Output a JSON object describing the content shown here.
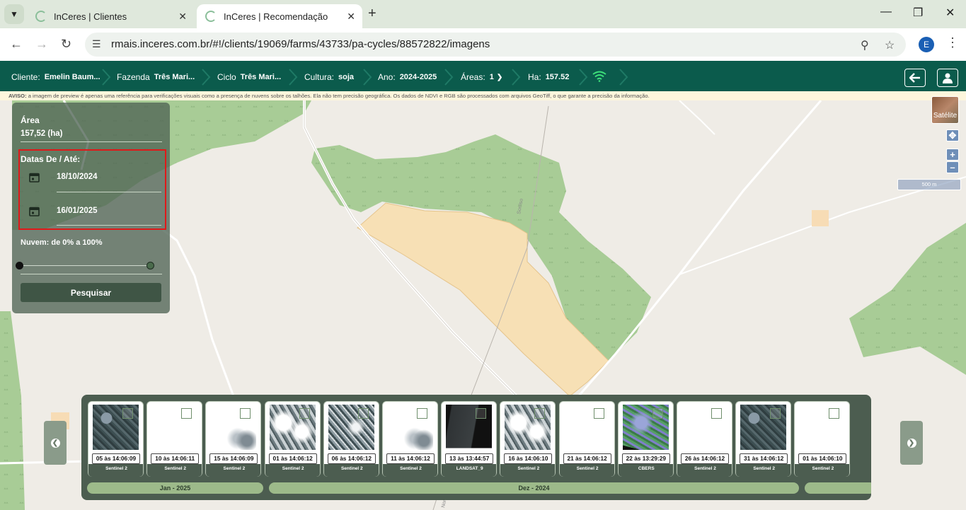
{
  "browser": {
    "tabs": [
      {
        "title": "InCeres | Clientes"
      },
      {
        "title": "InCeres | Recomendação"
      }
    ],
    "url": "rmais.inceres.com.br/#!/clients/19069/farms/43733/pa-cycles/88572822/imagens",
    "profile_initial": "E"
  },
  "header": {
    "cliente_label": "Cliente:",
    "cliente_value": "Emelin Baum...",
    "fazenda_label": "Fazenda",
    "fazenda_value": "Três Mari...",
    "ciclo_label": "Ciclo",
    "ciclo_value": "Três Mari...",
    "cultura_label": "Cultura:",
    "cultura_value": "soja",
    "ano_label": "Ano:",
    "ano_value": "2024-2025",
    "areas_label": "Áreas:",
    "areas_value": "1",
    "ha_label": "Ha:",
    "ha_value": "157.52"
  },
  "warning": {
    "prefix": "AVISO:",
    "text": " a imagem de preview é apenas uma referência para verificações visuais como a presença de nuvens sobre os talhões. Ela não tem precisão geográfica. Os dados de NDVI e RGB são processados com arquivos GeoTiff, o que garante a precisão da informação."
  },
  "panel": {
    "area_label": "Área",
    "area_value": "157,52 (ha)",
    "dates_label": "Datas De / Até:",
    "date_from": "18/10/2024",
    "date_to": "16/01/2025",
    "cloud_label": "Nuvem: de 0% a 100%",
    "cloud_min_pct": 0,
    "cloud_max_pct": 100,
    "search_label": "Pesquisar"
  },
  "map": {
    "satellite_label": "Satélite",
    "scale_label": "500 m",
    "road_labels": [
      "Sorriso",
      "Norte"
    ]
  },
  "images": [
    {
      "date": "05 às 14:06:09",
      "source": "Sentinel 2",
      "style": "forest"
    },
    {
      "date": "10 às 14:06:11",
      "source": "Sentinel 2",
      "style": "white"
    },
    {
      "date": "15 às 14:06:09",
      "source": "Sentinel 2",
      "style": "cloud-light"
    },
    {
      "date": "01 às 14:06:12",
      "source": "Sentinel 2",
      "style": "cloud-mixed"
    },
    {
      "date": "06 às 14:06:12",
      "source": "Sentinel 2",
      "style": "forest-cloud"
    },
    {
      "date": "11 às 14:06:12",
      "source": "Sentinel 2",
      "style": "cloud-light"
    },
    {
      "date": "13 às 13:44:57",
      "source": "LANDSAT_9",
      "style": "dark"
    },
    {
      "date": "16 às 14:06:10",
      "source": "Sentinel 2",
      "style": "cloud-mixed"
    },
    {
      "date": "21 às 14:06:12",
      "source": "Sentinel 2",
      "style": "white"
    },
    {
      "date": "22 às 13:29:29",
      "source": "CBERS",
      "style": "cbers"
    },
    {
      "date": "26 às 14:06:12",
      "source": "Sentinel 2",
      "style": "white"
    },
    {
      "date": "31 às 14:06:12",
      "source": "Sentinel 2",
      "style": "forest"
    },
    {
      "date": "01 às 14:06:10",
      "source": "Sentinel 2",
      "style": "white"
    }
  ],
  "months": [
    {
      "label": "Jan - 2025"
    },
    {
      "label": "Dez - 2024"
    },
    {
      "label": ""
    }
  ],
  "colors": {
    "header_bg": "#0b5b4c",
    "highlight": "#e01919",
    "vegetation": "#a8cc96",
    "field": "#f7e0b5"
  }
}
